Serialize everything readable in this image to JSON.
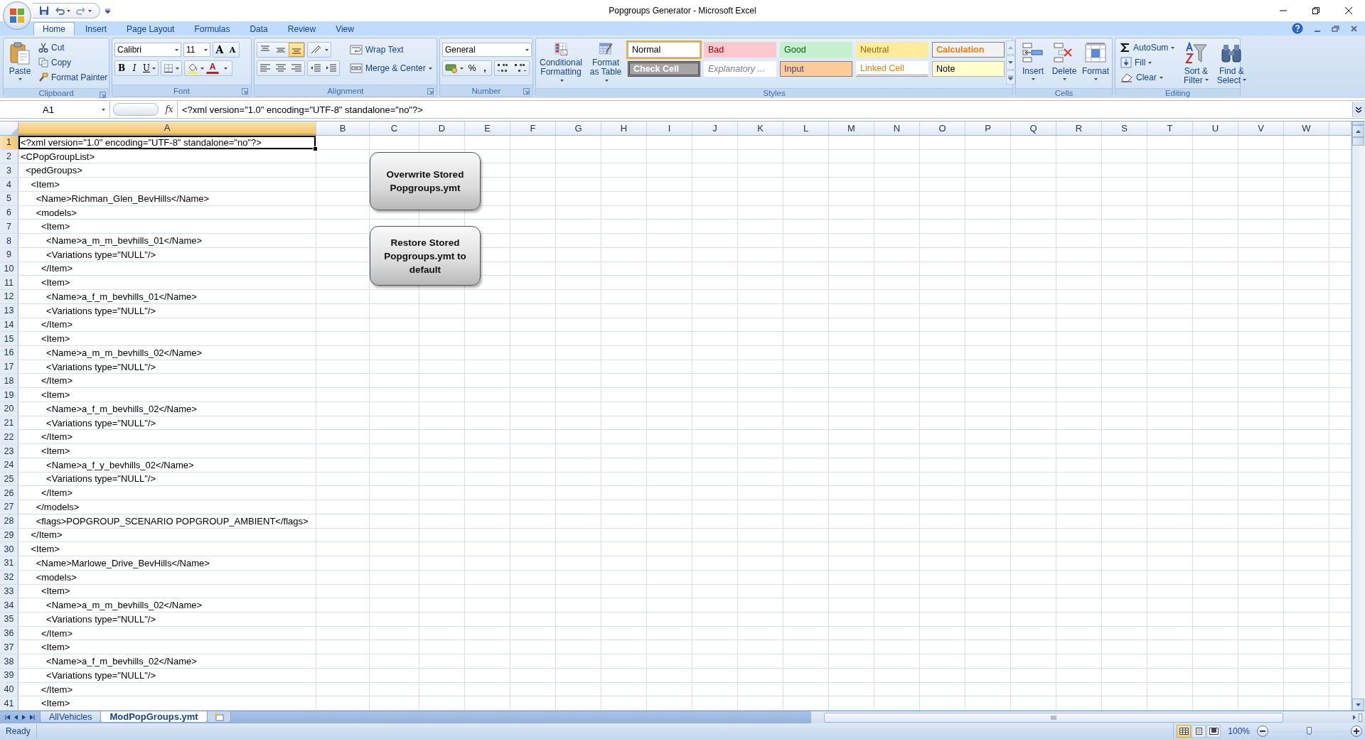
{
  "title_bar": {
    "title": "Popgroups Generator - Microsoft Excel"
  },
  "tabs": [
    {
      "label": "Home",
      "selected": true
    },
    {
      "label": "Insert",
      "selected": false
    },
    {
      "label": "Page Layout",
      "selected": false
    },
    {
      "label": "Formulas",
      "selected": false
    },
    {
      "label": "Data",
      "selected": false
    },
    {
      "label": "Review",
      "selected": false
    },
    {
      "label": "View",
      "selected": false
    }
  ],
  "ribbon": {
    "clipboard": {
      "label": "Clipboard",
      "dialog_launcher": true,
      "paste": "Paste",
      "commands": [
        "Cut",
        "Copy",
        "Format Painter"
      ]
    },
    "font": {
      "label": "Font",
      "dialog_launcher": true,
      "font_name": "Calibri",
      "font_size": "11",
      "grow": "A",
      "shrink": "A",
      "bold": "B",
      "italic": "I",
      "underline": "U",
      "font_color": "A"
    },
    "alignment": {
      "label": "Alignment",
      "dialog_launcher": true,
      "vertical_align": [
        {
          "selected": false
        },
        {
          "selected": false
        },
        {
          "selected": true
        }
      ],
      "wrap_text": "Wrap Text",
      "merge": "Merge & Center"
    },
    "number": {
      "label": "Number",
      "dialog_launcher": true,
      "format": "General",
      "percent": "%",
      "comma": ","
    },
    "styles": {
      "label": "Styles",
      "conditional": "Conditional Formatting",
      "format_table": "Format as Table",
      "gallery": [
        {
          "label": "Normal",
          "kind": "normal",
          "selected": true
        },
        {
          "label": "Bad",
          "kind": "bad",
          "selected": false
        },
        {
          "label": "Good",
          "kind": "good",
          "selected": false
        },
        {
          "label": "Neutral",
          "kind": "neutral",
          "selected": false
        },
        {
          "label": "Calculation",
          "kind": "calculation",
          "selected": false
        },
        {
          "label": "Check Cell",
          "kind": "check",
          "selected": false
        },
        {
          "label": "Explanatory ...",
          "kind": "explanatory",
          "selected": false
        },
        {
          "label": "Input",
          "kind": "input",
          "selected": false
        },
        {
          "label": "Linked Cell",
          "kind": "linked",
          "selected": false
        },
        {
          "label": "Note",
          "kind": "note",
          "selected": false
        }
      ]
    },
    "cells": {
      "label": "Cells",
      "buttons": [
        "Insert",
        "Delete",
        "Format"
      ]
    },
    "editing": {
      "label": "Editing",
      "commands": [
        "AutoSum",
        "Fill",
        "Clear"
      ],
      "sort": "Sort & Filter",
      "find": "Find & Select"
    }
  },
  "formula_bar": {
    "name_box": "A1",
    "fx": "fx",
    "formula": "<?xml version=\"1.0\" encoding=\"UTF-8\" standalone=\"no\"?>"
  },
  "sheet": {
    "columns": [
      {
        "label": "A",
        "selected": true
      },
      {
        "label": "B",
        "selected": false
      },
      {
        "label": "C",
        "selected": false
      },
      {
        "label": "D",
        "selected": false
      },
      {
        "label": "E",
        "selected": false
      },
      {
        "label": "F",
        "selected": false
      },
      {
        "label": "G",
        "selected": false
      },
      {
        "label": "H",
        "selected": false
      },
      {
        "label": "I",
        "selected": false
      },
      {
        "label": "J",
        "selected": false
      },
      {
        "label": "K",
        "selected": false
      },
      {
        "label": "L",
        "selected": false
      },
      {
        "label": "M",
        "selected": false
      },
      {
        "label": "N",
        "selected": false
      },
      {
        "label": "O",
        "selected": false
      },
      {
        "label": "P",
        "selected": false
      },
      {
        "label": "Q",
        "selected": false
      },
      {
        "label": "R",
        "selected": false
      },
      {
        "label": "S",
        "selected": false
      },
      {
        "label": "T",
        "selected": false
      },
      {
        "label": "U",
        "selected": false
      },
      {
        "label": "V",
        "selected": false
      },
      {
        "label": "W",
        "selected": false
      }
    ],
    "rows": [
      {
        "number": "1",
        "text": "<?xml version=\"1.0\" encoding=\"UTF-8\" standalone=\"no\"?>",
        "selected": true
      },
      {
        "number": "2",
        "text": "<CPopGroupList>",
        "selected": false
      },
      {
        "number": "3",
        "text": "  <pedGroups>",
        "selected": false
      },
      {
        "number": "4",
        "text": "    <Item>",
        "selected": false
      },
      {
        "number": "5",
        "text": "      <Name>Richman_Glen_BevHills</Name>",
        "selected": false
      },
      {
        "number": "6",
        "text": "      <models>",
        "selected": false
      },
      {
        "number": "7",
        "text": "        <Item>",
        "selected": false
      },
      {
        "number": "8",
        "text": "          <Name>a_m_m_bevhills_01</Name>",
        "selected": false
      },
      {
        "number": "9",
        "text": "          <Variations type=\"NULL\"/>",
        "selected": false
      },
      {
        "number": "10",
        "text": "        </Item>",
        "selected": false
      },
      {
        "number": "11",
        "text": "        <Item>",
        "selected": false
      },
      {
        "number": "12",
        "text": "          <Name>a_f_m_bevhills_01</Name>",
        "selected": false
      },
      {
        "number": "13",
        "text": "          <Variations type=\"NULL\"/>",
        "selected": false
      },
      {
        "number": "14",
        "text": "        </Item>",
        "selected": false
      },
      {
        "number": "15",
        "text": "        <Item>",
        "selected": false
      },
      {
        "number": "16",
        "text": "          <Name>a_m_m_bevhills_02</Name>",
        "selected": false
      },
      {
        "number": "17",
        "text": "          <Variations type=\"NULL\"/>",
        "selected": false
      },
      {
        "number": "18",
        "text": "        </Item>",
        "selected": false
      },
      {
        "number": "19",
        "text": "        <Item>",
        "selected": false
      },
      {
        "number": "20",
        "text": "          <Name>a_f_m_bevhills_02</Name>",
        "selected": false
      },
      {
        "number": "21",
        "text": "          <Variations type=\"NULL\"/>",
        "selected": false
      },
      {
        "number": "22",
        "text": "        </Item>",
        "selected": false
      },
      {
        "number": "23",
        "text": "        <Item>",
        "selected": false
      },
      {
        "number": "24",
        "text": "          <Name>a_f_y_bevhills_02</Name>",
        "selected": false
      },
      {
        "number": "25",
        "text": "          <Variations type=\"NULL\"/>",
        "selected": false
      },
      {
        "number": "26",
        "text": "        </Item>",
        "selected": false
      },
      {
        "number": "27",
        "text": "      </models>",
        "selected": false
      },
      {
        "number": "28",
        "text": "      <flags>POPGROUP_SCENARIO POPGROUP_AMBIENT</flags>",
        "selected": false
      },
      {
        "number": "29",
        "text": "    </Item>",
        "selected": false
      },
      {
        "number": "30",
        "text": "    <Item>",
        "selected": false
      },
      {
        "number": "31",
        "text": "      <Name>Marlowe_Drive_BevHills</Name>",
        "selected": false
      },
      {
        "number": "32",
        "text": "      <models>",
        "selected": false
      },
      {
        "number": "33",
        "text": "        <Item>",
        "selected": false
      },
      {
        "number": "34",
        "text": "          <Name>a_m_m_bevhills_02</Name>",
        "selected": false
      },
      {
        "number": "35",
        "text": "          <Variations type=\"NULL\"/>",
        "selected": false
      },
      {
        "number": "36",
        "text": "        </Item>",
        "selected": false
      },
      {
        "number": "37",
        "text": "        <Item>",
        "selected": false
      },
      {
        "number": "38",
        "text": "          <Name>a_f_m_bevhills_02</Name>",
        "selected": false
      },
      {
        "number": "39",
        "text": "          <Variations type=\"NULL\"/>",
        "selected": false
      },
      {
        "number": "40",
        "text": "        </Item>",
        "selected": false
      },
      {
        "number": "41",
        "text": "        <Item>",
        "selected": false
      }
    ],
    "shapes": [
      "Overwrite Stored Popgroups.ymt",
      "Restore Stored Popgroups.ymt to default"
    ]
  },
  "sheet_tabs": [
    {
      "label": "AllVehicles",
      "selected": false
    },
    {
      "label": "ModPopGroups.ymt",
      "selected": true
    }
  ],
  "status_bar": {
    "status": "Ready",
    "views": [
      {
        "selected": true
      },
      {
        "selected": false
      },
      {
        "selected": false
      }
    ],
    "zoom": "100%",
    "zoom_slider": {
      "level": 0.5
    }
  }
}
